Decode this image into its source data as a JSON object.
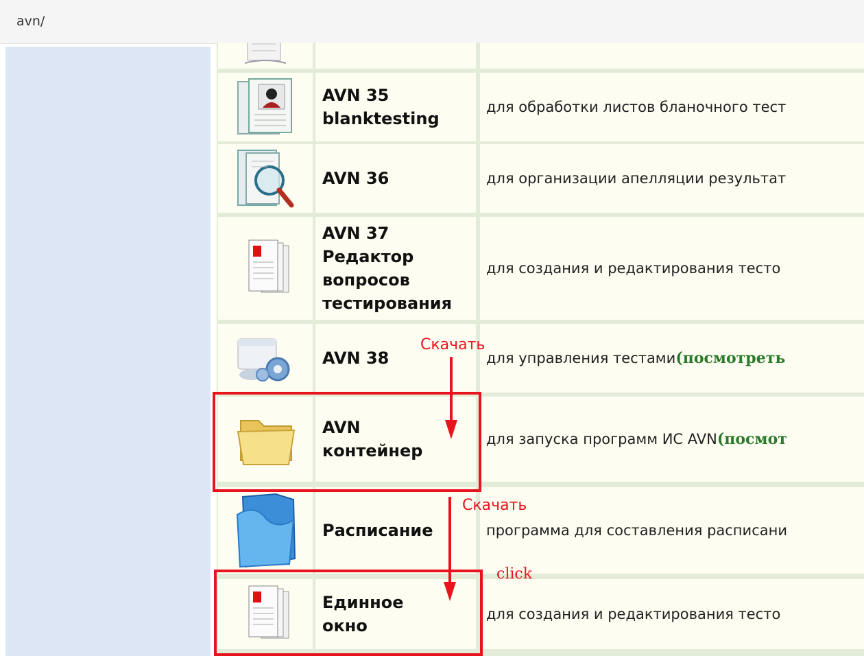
{
  "path": "avn/",
  "rows": [
    {
      "title": "",
      "desc": "",
      "icon": "document-stack-icon"
    },
    {
      "title": "AVN 35\nblanktesting",
      "desc": "для обработки листов бланочного тест",
      "icon": "user-card-icon"
    },
    {
      "title": "AVN 36",
      "desc": "для организации апелляции результат",
      "icon": "magnifier-document-icon"
    },
    {
      "title": "AVN 37\nРедактор\nвопросов\nтестирования",
      "desc": "для создания и редактирования тесто",
      "icon": "document-stack-icon"
    },
    {
      "title": "AVN 38",
      "desc": "для управления тестами",
      "link": "(посмотреть",
      "icon": "gear-window-icon"
    },
    {
      "title": "AVN\nконтейнер",
      "desc": "для запуска программ ИС AVN",
      "link": "(посмот",
      "icon": "yellow-folder-icon"
    },
    {
      "title": "Расписание",
      "desc": "программа для составления расписани",
      "icon": "blue-folder-icon"
    },
    {
      "title": "Единное\nокно",
      "desc": "для создания и редактирования тесто",
      "icon": "document-stack-icon"
    }
  ],
  "annotations": {
    "download_1": "Скачать",
    "download_2": "Скачать",
    "click": "click"
  },
  "colors": {
    "highlight": "#e8141d",
    "link": "#2a7a2a",
    "cell": "#fdfdf1",
    "grid": "#e2ecd8",
    "sidebar": "#dde6f4"
  }
}
